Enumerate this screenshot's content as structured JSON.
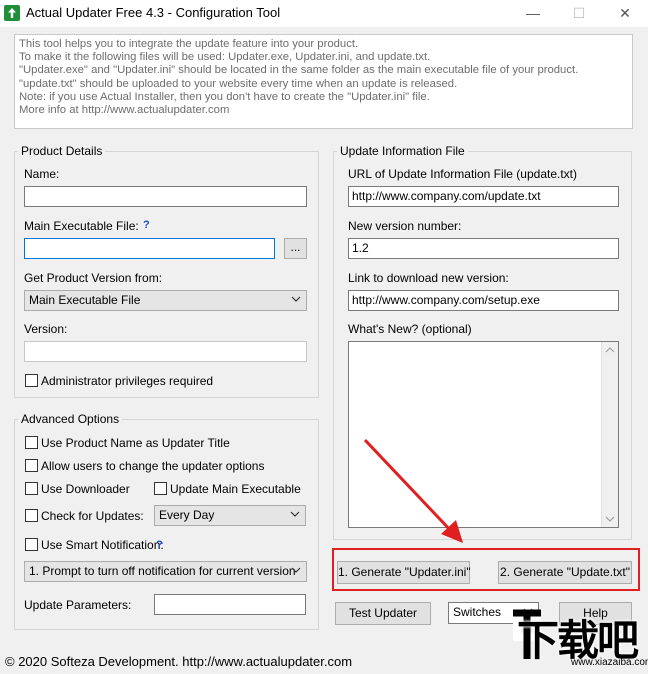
{
  "window": {
    "title": "Actual Updater Free 4.3 - Configuration Tool",
    "minimize": "—",
    "maximize": "☐",
    "close": "✕"
  },
  "info_lines": [
    "This tool helps you to integrate the update feature into your product.",
    "To make it the following files will be used: Updater.exe, Updater.ini, and update.txt.",
    "\"Updater.exe\" and \"Updater.ini\" should be located in the same folder as the main executable file of your product.",
    "\"update.txt\" should be uploaded to your website every time when an update is released.",
    "Note: if you use Actual Installer, then you don't have to create the \"Updater.ini\" file.",
    "More info at http://www.actualupdater.com"
  ],
  "product": {
    "legend": "Product Details",
    "name_label": "Name:",
    "name_value": "",
    "exe_label": "Main Executable File:",
    "help_mark": "?",
    "exe_value": "",
    "browse_label": "...",
    "version_from_label": "Get Product Version from:",
    "version_from_value": "Main Executable File",
    "version_label": "Version:",
    "version_value": "",
    "admin_label": "Administrator privileges required"
  },
  "update": {
    "legend": "Update Information File",
    "url_label": "URL of Update Information File (update.txt)",
    "url_value": "http://www.company.com/update.txt",
    "newver_label": "New version number:",
    "newver_value": "1.2",
    "download_label": "Link to download new version:",
    "download_value": "http://www.company.com/setup.exe",
    "whatsnew_label": "What's New? (optional)",
    "whatsnew_value": ""
  },
  "advanced": {
    "legend": "Advanced Options",
    "use_title": "Use Product Name as Updater Title",
    "allow_change": "Allow users to change the updater options",
    "use_downloader": "Use Downloader",
    "update_main": "Update Main Executable",
    "check_updates": "Check for Updates:",
    "check_freq": "Every Day",
    "smart_notif": "Use Smart Notification:",
    "help_mark": "?",
    "notif_option": "1. Prompt to turn off notification for current version",
    "params_label": "Update Parameters:",
    "params_value": ""
  },
  "buttons": {
    "gen_ini": "1. Generate \"Updater.ini\"",
    "gen_txt": "2. Generate \"Update.txt\"",
    "test": "Test Updater",
    "switches": "Switches",
    "help": "Help"
  },
  "footer": "© 2020 Softeza Development.  http://www.actualupdater.com",
  "watermark": {
    "main": "下载吧",
    "url": "www.xiazaiba.com"
  },
  "colors": {
    "accent": "#0078d7",
    "annotation": "#e02020",
    "help": "#1e4fd0"
  }
}
